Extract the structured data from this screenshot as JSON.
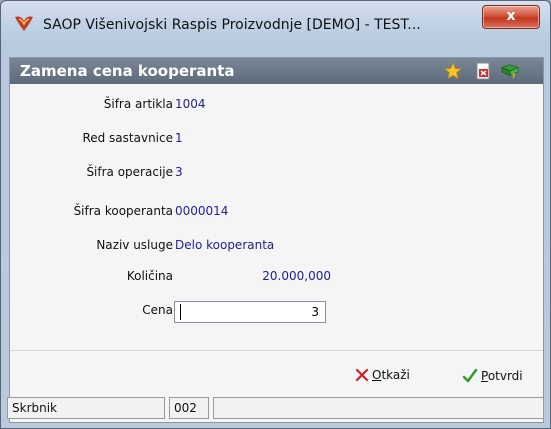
{
  "window": {
    "title": "SAOP  Višenivojski Raspis Proizvodnje [DEMO] - TEST...",
    "close_label": "x"
  },
  "form": {
    "header": "Zamena cena kooperanta",
    "fields": [
      {
        "label": "Šifra artikla",
        "value": "1004"
      },
      {
        "label": "Red sastavnice",
        "value": "1"
      },
      {
        "label": "Šifra operacije",
        "value": "3"
      },
      {
        "label": "Šifra kooperanta",
        "value": "0000014"
      },
      {
        "label": "Naziv usluge",
        "value": "Delo kooperanta"
      },
      {
        "label": "Količina",
        "value": "20.000,000"
      }
    ],
    "cena_label": "Cena",
    "cena_value": "3"
  },
  "buttons": {
    "cancel_first": "O",
    "cancel_rest": "tkaži",
    "confirm_first": "P",
    "confirm_rest": "otvrdi"
  },
  "statusbar": {
    "user": "Skrbnik",
    "code": "002"
  },
  "icons": {
    "app": "saop-logo-icon",
    "favorite": "star-icon",
    "pdf": "pdf-document-icon",
    "help": "help-book-icon"
  },
  "colors": {
    "header_bar": "#6b7886",
    "value_text": "#20209a",
    "cancel_x": "#d02020",
    "confirm_check": "#2a9a2a"
  }
}
